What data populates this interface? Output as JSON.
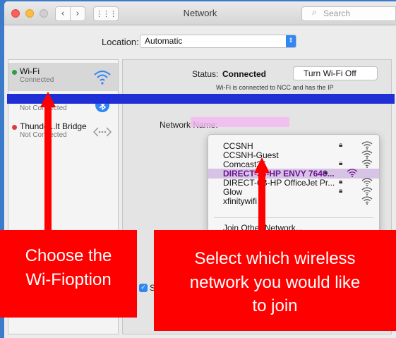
{
  "window": {
    "title": "Network",
    "search_placeholder": "Search",
    "back_glyph": "‹",
    "forward_glyph": "›",
    "grid_glyph": "⋮⋮⋮"
  },
  "location": {
    "label": "Location:",
    "value": "Automatic"
  },
  "sidebar": {
    "items": [
      {
        "name": "Wi-Fi",
        "status": "Connected",
        "dot_color": "#2ea043"
      },
      {
        "name": "B",
        "status": "Not Connected",
        "dot_color": "#e0393e"
      },
      {
        "name": "Thunde...lt Bridge",
        "status": "Not Connected",
        "dot_color": "#e0393e"
      }
    ]
  },
  "detail": {
    "status_label": "Status:",
    "status_value": "Connected",
    "turn_off_button": "Turn Wi-Fi Off",
    "status_description": "Wi-Fi is connected to NCC and has the IP",
    "network_name_label": "Network Name:",
    "ask_checkbox_label": "S"
  },
  "networks": [
    {
      "name": "CCSNH",
      "locked": true
    },
    {
      "name": "CCSNH-Guest",
      "locked": false
    },
    {
      "name": "Comcast25",
      "locked": true
    },
    {
      "name": "DIRECT-35-HP ENVY 7640...",
      "locked": true,
      "highlighted": true
    },
    {
      "name": "DIRECT-6B-HP OfficeJet Pr...",
      "locked": true
    },
    {
      "name": "Glow",
      "locked": true
    },
    {
      "name": "xfinitywifi",
      "locked": false
    }
  ],
  "join_other": "Join Other Network...",
  "annotations": {
    "left_line1": "Choose the",
    "left_line2": "Wi-Fioption",
    "right_line1": "Select which wireless",
    "right_line2": "network you would like",
    "right_line3": "to join"
  },
  "colors": {
    "accent_blue": "#2f86f4",
    "annotation_red": "#ff0000",
    "highlight_purple": "#6a138f"
  }
}
